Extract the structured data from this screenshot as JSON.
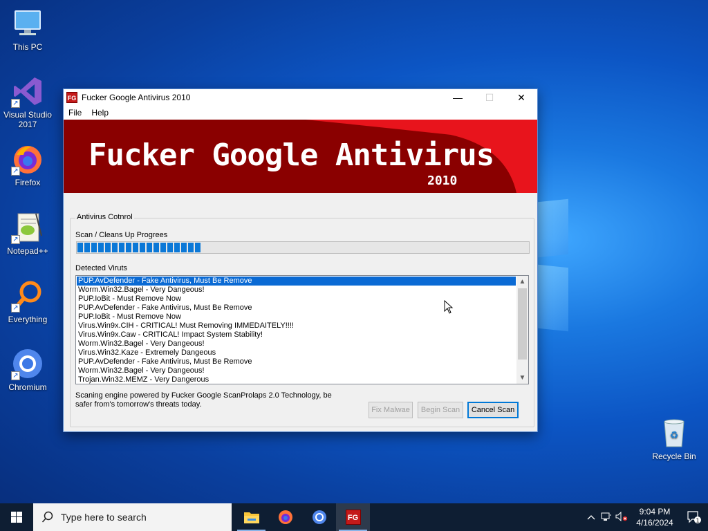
{
  "desktop": {
    "icons": [
      {
        "label": "This PC"
      },
      {
        "label": "Visual Studio 2017"
      },
      {
        "label": "Firefox"
      },
      {
        "label": "Notepad++"
      },
      {
        "label": "Everything"
      },
      {
        "label": "Chromium"
      },
      {
        "label": "Recycle Bin"
      }
    ]
  },
  "window": {
    "icon_text": "FG",
    "title": "Fucker Google Antivirus 2010",
    "controls": {
      "minimize": "—",
      "maximize": "☐",
      "close": "✕"
    },
    "menu": [
      "File",
      "Help"
    ],
    "banner": {
      "title": "Fucker Google Antivirus",
      "year": "2010"
    },
    "group_title": "Antivirus Cotnrol",
    "progress_label": "Scan / Cleans Up Progrees",
    "progress_fraction": 0.27,
    "detected_label": "Detected Viruts",
    "detected": [
      "PUP.AvDefender - Fake Antivirus, Must Be Remove",
      "Worm.Win32.Bagel - Very Dangeous!",
      "PUP.IoBit - Must Remove Now",
      "PUP.AvDefender - Fake Antivirus, Must Be Remove",
      "PUP.IoBit - Must Remove Now",
      "Virus.Win9x.CIH - CRITICAL! Must Removing IMMEDAITELY!!!!",
      "Virus.Win9x.Caw - CRITICAL! Impact System Stability!",
      "Worm.Win32.Bagel - Very Dangeous!",
      "Virus.Win32.Kaze  - Extremely Dangeous",
      "PUP.AvDefender - Fake Antivirus, Must Be Remove",
      "Worm.Win32.Bagel - Very Dangeous!",
      "Trojan.Win32.MEMZ - Very Dangerous"
    ],
    "selected_index": 0,
    "footer": "Scaning engine powered by Fucker Google ScanProlaps 2.0 Technology, be safer from's tomorrow's threats today.",
    "buttons": {
      "fix": "Fix Malwae",
      "begin": "Begin Scan",
      "cancel": "Cancel Scan"
    }
  },
  "taskbar": {
    "search_placeholder": "Type here to search",
    "apps": [
      "file-explorer",
      "firefox",
      "chromium",
      "fucker-google-antivirus"
    ],
    "active_app_text": "FG",
    "time": "9:04 PM",
    "date": "4/16/2024",
    "notification_count": "1"
  },
  "colors": {
    "banner_dark": "#8a0000",
    "banner_red": "#e8141c",
    "selection": "#0a6ad4",
    "progress": "#0b78d7"
  }
}
